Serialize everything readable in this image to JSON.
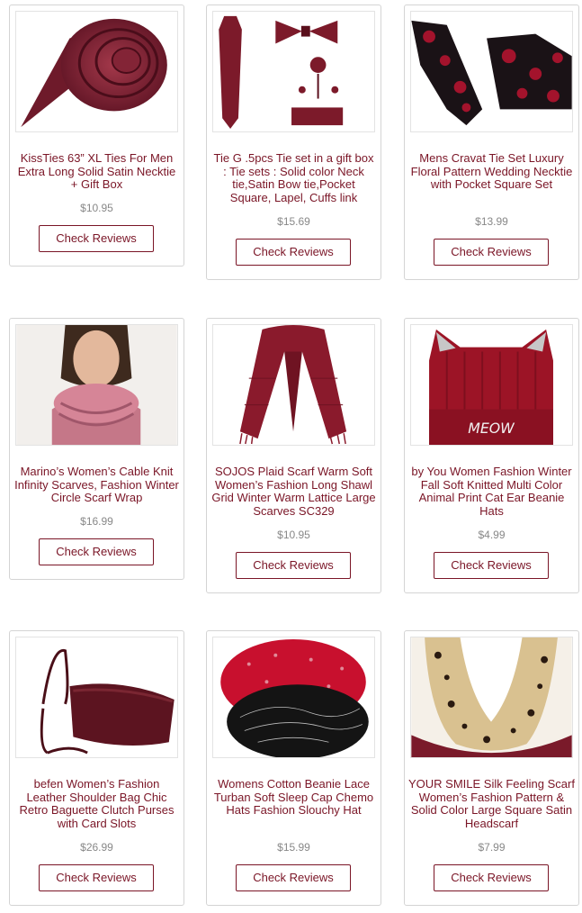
{
  "products": [
    {
      "title": "KissTies 63” XL Ties For Men Extra Long Solid Satin Necktie + Gift Box",
      "price": "$10.95",
      "button": "Check Reviews"
    },
    {
      "title": "Tie G .5pcs Tie set in a gift box : Tie sets : Solid color Neck tie,Satin Bow tie,Pocket Square, Lapel, Cuffs link",
      "price": "$15.69",
      "button": "Check Reviews"
    },
    {
      "title": "Mens Cravat Tie Set Luxury Floral Pattern Wedding Necktie with Pocket Square Set",
      "price": "$13.99",
      "button": "Check Reviews"
    },
    {
      "title": "Marino’s Women’s Cable Knit Infinity Scarves, Fashion Winter Circle Scarf Wrap",
      "price": "$16.99",
      "button": "Check Reviews"
    },
    {
      "title": "SOJOS Plaid Scarf Warm Soft Women’s Fashion Long Shawl Grid Winter Warm Lattice Large Scarves SC329",
      "price": "$10.95",
      "button": "Check Reviews"
    },
    {
      "title": "by You Women Fashion Winter Fall Soft Knitted Multi Color Animal Print Cat Ear Beanie Hats",
      "price": "$4.99",
      "button": "Check Reviews"
    },
    {
      "title": "befen Women’s Fashion Leather Shoulder Bag Chic Retro Baguette Clutch Purses with Card Slots",
      "price": "$26.99",
      "button": "Check Reviews"
    },
    {
      "title": "Womens Cotton Beanie Lace Turban Soft Sleep Cap Chemo Hats Fashion Slouchy Hat",
      "price": "$15.99",
      "button": "Check Reviews"
    },
    {
      "title": "YOUR SMILE Silk Feeling Scarf Women’s Fashion Pattern & Solid Color Large Square Satin Headscarf",
      "price": "$7.99",
      "button": "Check Reviews"
    }
  ],
  "images": {
    "beanie_text": "MEOW"
  },
  "colors": {
    "accent": "#7a1526",
    "price": "#888888",
    "border": "#d4d4d4"
  }
}
